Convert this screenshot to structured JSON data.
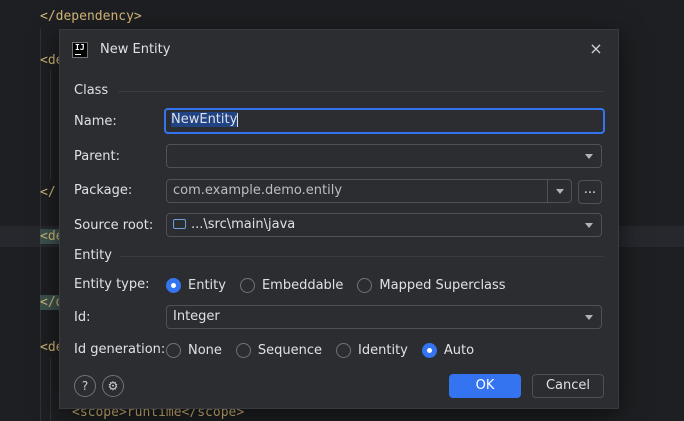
{
  "editor": {
    "lines": [
      {
        "text": "</dependency>"
      },
      {
        "text": "<de"
      },
      {
        "text": "</"
      },
      {
        "text": "<de"
      },
      {
        "text": "</d"
      },
      {
        "text": "<de"
      },
      {
        "text": "<scope>runtime</scope>"
      }
    ]
  },
  "dialog": {
    "title": "New Entity",
    "close_icon": "×",
    "app_icon_text": "IJ",
    "class_section": "Class",
    "name_label": "Name:",
    "name_value": "NewEntity",
    "parent_label": "Parent:",
    "parent_value": "",
    "package_label": "Package:",
    "package_value": "com.example.demo.entily",
    "package_browse": "...",
    "source_root_label": "Source root:",
    "source_root_value": "...\\src\\main\\java",
    "entity_section": "Entity",
    "entity_type_label": "Entity type:",
    "entity_types": [
      {
        "label": "Entity",
        "selected": true
      },
      {
        "label": "Embeddable",
        "selected": false
      },
      {
        "label": "Mapped Superclass",
        "selected": false
      }
    ],
    "id_label": "Id:",
    "id_value": "Integer",
    "id_generation_label": "Id generation:",
    "id_generations": [
      {
        "label": "None",
        "selected": false
      },
      {
        "label": "Sequence",
        "selected": false
      },
      {
        "label": "Identity",
        "selected": false
      },
      {
        "label": "Auto",
        "selected": true
      }
    ],
    "help_icon": "?",
    "settings_icon": "⚙",
    "ok_label": "OK",
    "cancel_label": "Cancel"
  },
  "colors": {
    "accent": "#3574f0",
    "dialog_bg": "#2b2d30",
    "editor_bg": "#1e1f22",
    "tag": "#d5b778"
  }
}
